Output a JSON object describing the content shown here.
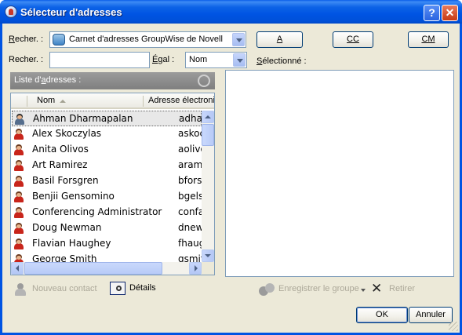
{
  "window": {
    "title": "Sélecteur d'adresses",
    "help_button": "?",
    "close_button": "✕"
  },
  "search_row1": {
    "label_prefix": "R",
    "label_rest": "echer. :",
    "source_value": "Carnet d'adresses GroupWise de Novell"
  },
  "search_row2": {
    "label": "Recher. :",
    "search_value": "",
    "equal_label_underlined": "É",
    "equal_label_rest": "gal :",
    "field_value": "Nom"
  },
  "recipient_buttons": {
    "to": "A",
    "cc": "CC",
    "bcc": "CM"
  },
  "selected_label_underlined": "S",
  "selected_label_rest": "électionné :",
  "address_list": {
    "header_prefix": "Liste d'",
    "header_underlined": "a",
    "header_rest": "dresses :",
    "columns": {
      "name": "Nom",
      "email": "Adresse électronique"
    },
    "rows": [
      {
        "name": "Ahman Dharmapalan",
        "email": "adharmapalan"
      },
      {
        "name": "Alex Skoczylas",
        "email": "askoczylas"
      },
      {
        "name": "Anita Olivos",
        "email": "aolivos"
      },
      {
        "name": "Art Ramirez",
        "email": "aramirez"
      },
      {
        "name": "Basil Forsgren",
        "email": "bforsgren"
      },
      {
        "name": "Benjii Gensomino",
        "email": "bgelsomino"
      },
      {
        "name": "Conferencing Administrator",
        "email": "confadmin"
      },
      {
        "name": "Doug Newman",
        "email": "dnewman"
      },
      {
        "name": "Flavian Haughey",
        "email": "fhaughey"
      },
      {
        "name": "George Smith",
        "email": "gsmith"
      }
    ]
  },
  "actions": {
    "new_contact": "Nouveau contact",
    "details": "Détails",
    "save_group": "Enregistrer le groupe",
    "remove": "Retirer"
  },
  "dialog_buttons": {
    "ok": "OK",
    "cancel": "Annuler"
  },
  "colors": {
    "titlebar": "#0054e3",
    "client_bg": "#ece9d8",
    "list_header_bg": "#8c8c8c",
    "disabled_text": "#aca899"
  }
}
